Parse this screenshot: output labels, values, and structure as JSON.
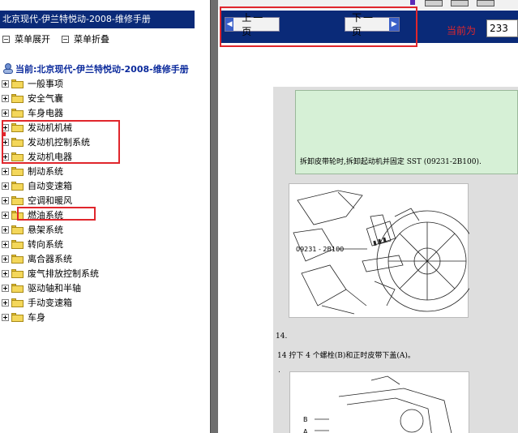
{
  "sidebar": {
    "title": "北京现代-伊兰特悦动-2008-维修手册",
    "expand_label": "菜单展开",
    "collapse_label": "菜单折叠",
    "root_label": "当前:北京现代-伊兰特悦动-2008-维修手册",
    "items": [
      {
        "label": "一般事项"
      },
      {
        "label": "安全气囊"
      },
      {
        "label": "车身电器"
      },
      {
        "label": "发动机机械"
      },
      {
        "label": "发动机控制系统"
      },
      {
        "label": "发动机电器"
      },
      {
        "label": "制动系统"
      },
      {
        "label": "自动变速箱"
      },
      {
        "label": "空调和暖风"
      },
      {
        "label": "燃油系统"
      },
      {
        "label": "悬架系统"
      },
      {
        "label": "转向系统"
      },
      {
        "label": "离合器系统"
      },
      {
        "label": "废气排放控制系统"
      },
      {
        "label": "驱动轴和半轴"
      },
      {
        "label": "手动变速箱"
      },
      {
        "label": "车身"
      }
    ]
  },
  "nav": {
    "prev_label": "上一页",
    "next_label": "下一页",
    "prev_arrow": "◀",
    "next_arrow": "▶",
    "page_label": "当前为",
    "page_value": "233"
  },
  "doc": {
    "note_text": "拆卸皮带轮时,拆卸起动机并固定 SST (09231-2B100).",
    "figure1_callout": "09231 - 2B100",
    "step_number": "14.",
    "step_text": "14  拧下 4 个螺栓(B)和正时皮带下盖(A)。",
    "step_dot": ".",
    "figure2_label_b": "B",
    "figure2_label_a": "A"
  },
  "colors": {
    "nav_bg": "#0a2a78",
    "highlight": "#e0262c",
    "note_bg": "#d6f0d6",
    "folder": "#f4d75a",
    "root_text": "#0b2a9c"
  }
}
